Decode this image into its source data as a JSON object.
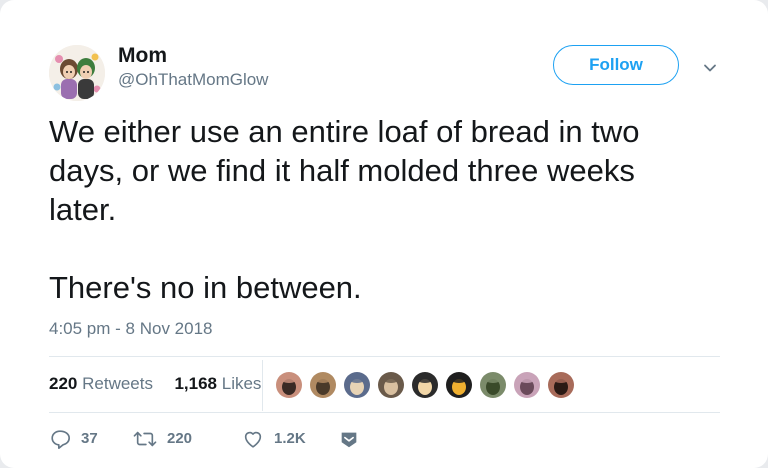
{
  "user": {
    "name": "Mom",
    "handle": "@OhThatMomGlow"
  },
  "follow_label": "Follow",
  "tweet": {
    "text": "We either use an entire loaf of bread in two\ndays, or we find it half molded three weeks\nlater.\n\nThere's no in between.",
    "timestamp": "4:05 pm - 8 Nov 2018"
  },
  "stats": {
    "retweets": {
      "count": "220",
      "label": "Retweets"
    },
    "likes": {
      "count": "1,168",
      "label": "Likes"
    }
  },
  "liker_avatars": [
    {
      "colors": [
        "#c98f7c",
        "#3a2a25"
      ]
    },
    {
      "colors": [
        "#b08a62",
        "#4a3a2a"
      ]
    },
    {
      "colors": [
        "#5b6b8c",
        "#e7d3b5"
      ]
    },
    {
      "colors": [
        "#6a5a4a",
        "#d9c0a0"
      ]
    },
    {
      "colors": [
        "#2b2b2b",
        "#f2d7a8"
      ]
    },
    {
      "colors": [
        "#1f1f1f",
        "#f0b030"
      ]
    },
    {
      "colors": [
        "#7b8b6a",
        "#3a4a2a"
      ]
    },
    {
      "colors": [
        "#c9a3b8",
        "#6a4a5a"
      ]
    },
    {
      "colors": [
        "#a86b5a",
        "#2a1a15"
      ]
    }
  ],
  "actions": {
    "reply": {
      "count": "37"
    },
    "retweet": {
      "count": "220"
    },
    "like": {
      "count": "1.2K"
    }
  },
  "colors": {
    "accent": "#1da1f2",
    "muted": "#657786",
    "text": "#14171a",
    "divider": "#e1e8ed"
  },
  "icons": [
    "reply-icon",
    "retweet-icon",
    "heart-icon",
    "message-icon",
    "chevron-down-icon"
  ]
}
